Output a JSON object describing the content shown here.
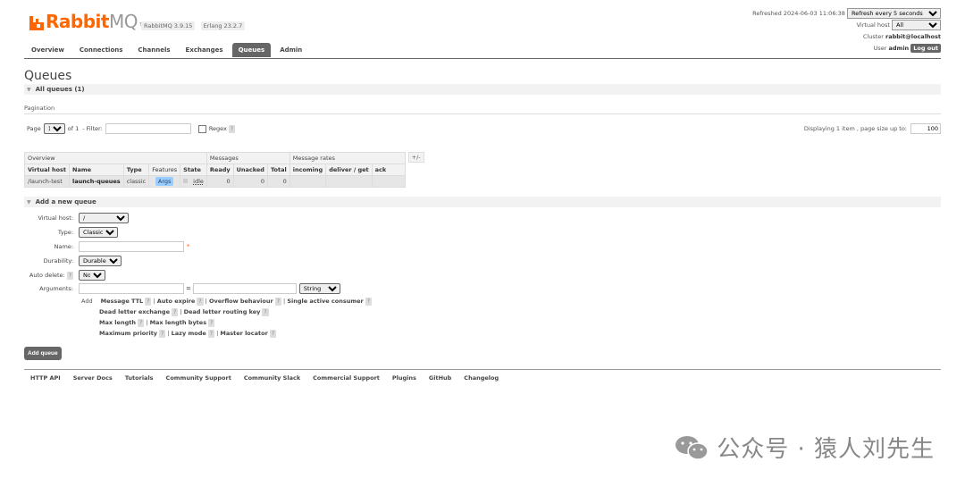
{
  "header": {
    "logo_brand": "Rabbit",
    "logo_mq": "MQ",
    "logo_tm": "TM",
    "version": "RabbitMQ 3.9.15",
    "erlang": "Erlang 23.2.7",
    "refreshed": "Refreshed 2024-06-03 11:06:38",
    "refresh_select": "Refresh every 5 seconds",
    "vhost_label": "Virtual host",
    "vhost_value": "All",
    "cluster_label": "Cluster",
    "cluster_value": "rabbit@localhost",
    "user_label": "User",
    "user_value": "admin",
    "logout": "Log out"
  },
  "nav": [
    "Overview",
    "Connections",
    "Channels",
    "Exchanges",
    "Queues",
    "Admin"
  ],
  "nav_active": "Queues",
  "page_title": "Queues",
  "all_queues": "All queues (1)",
  "pagination": {
    "label": "Pagination",
    "page_label": "Page",
    "page_value": "1",
    "of": "of 1",
    "filter": "- Filter:",
    "regex": "Regex",
    "help": "?",
    "displaying": "Displaying 1 item , page size up to:",
    "page_size": "100"
  },
  "table": {
    "groups": [
      "Overview",
      "Messages",
      "Message rates"
    ],
    "plusminus": "+/-",
    "columns": [
      "Virtual host",
      "Name",
      "Type",
      "Features",
      "State",
      "Ready",
      "Unacked",
      "Total",
      "incoming",
      "deliver / get",
      "ack"
    ],
    "row": {
      "vhost": "/launch-test",
      "name": "launch-queues",
      "type": "classic",
      "feature": "Args",
      "state": "idle",
      "ready": "0",
      "unacked": "0",
      "total": "0"
    }
  },
  "add_queue": {
    "section": "Add a new queue",
    "vhost_label": "Virtual host:",
    "vhost_value": "/",
    "type_label": "Type:",
    "type_value": "Classic",
    "name_label": "Name:",
    "required": "*",
    "durability_label": "Durability:",
    "durability_value": "Durable",
    "autodelete_label": "Auto delete:",
    "autodelete_value": "No",
    "arguments_label": "Arguments:",
    "eq": "=",
    "arg_type": "String",
    "add": "Add",
    "args_line1": [
      "Message TTL",
      "Auto expire",
      "Overflow behaviour",
      "Single active consumer"
    ],
    "args_line2": [
      "Dead letter exchange",
      "Dead letter routing key"
    ],
    "args_line3": [
      "Max length",
      "Max length bytes"
    ],
    "args_line4": [
      "Maximum priority",
      "Lazy mode",
      "Master locator"
    ],
    "button": "Add queue"
  },
  "footer": [
    "HTTP API",
    "Server Docs",
    "Tutorials",
    "Community Support",
    "Community Slack",
    "Commercial Support",
    "Plugins",
    "GitHub",
    "Changelog"
  ],
  "watermark": "公众号 · 猿人刘先生",
  "colors": {
    "brand": "#ff6600",
    "nav_active": "#666666",
    "tag": "#99ccff"
  }
}
